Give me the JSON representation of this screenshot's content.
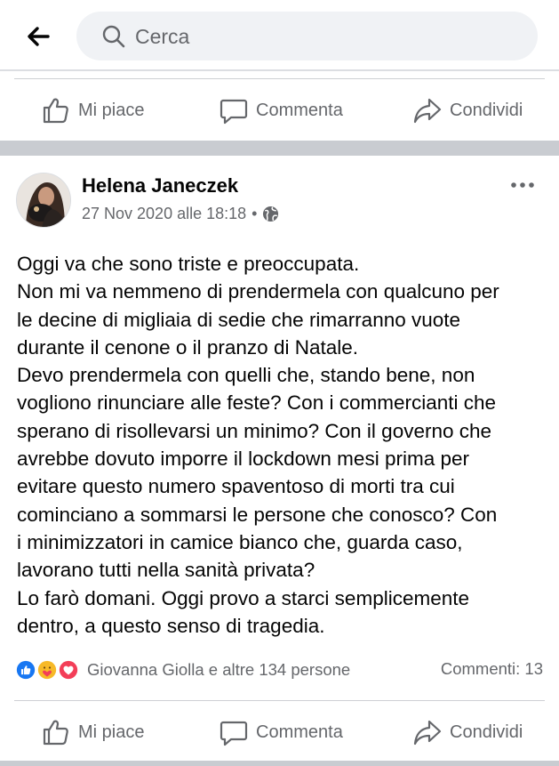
{
  "search": {
    "placeholder": "Cerca"
  },
  "actions": {
    "like": "Mi piace",
    "comment": "Commenta",
    "share": "Condividi"
  },
  "post": {
    "author": "Helena Janeczek",
    "timestamp": "27 Nov 2020 alle 18:18",
    "separator": "•",
    "privacy_icon": "globe-icon",
    "lines": [
      "Oggi va che sono triste e preoccupata.",
      "Non mi va nemmeno di prendermela con qualcuno per",
      "le decine di migliaia di sedie che rimarranno vuote",
      "durante il cenone o il pranzo di Natale.",
      "Devo prendermela con quelli che, stando bene, non",
      "vogliono rinunciare alle feste? Con i commercianti che",
      "sperano di risollevarsi un minimo? Con il governo che",
      "avrebbe dovuto imporre il lockdown mesi prima per",
      "evitare questo numero spaventoso di morti tra cui",
      "cominciano a sommarsi le persone che conosco? Con",
      "i minimizzatori in camice bianco che, guarda caso,",
      "lavorano tutti nella sanità privata?",
      "Lo farò domani. Oggi provo a starci semplicemente",
      "dentro, a questo senso di tragedia."
    ],
    "reactions": {
      "icons": [
        "like-icon",
        "care-icon",
        "love-icon"
      ],
      "summary": "Giovanna Giolla e altre 134 persone"
    },
    "comments_count": "Commenti: 13"
  },
  "colors": {
    "like_blue": "#1877f2",
    "love_red": "#f33e58",
    "care_yellow": "#f7b928",
    "secondary_text": "#65676b",
    "search_bg": "#f0f2f5",
    "separator_gray": "#c9ccd1"
  }
}
